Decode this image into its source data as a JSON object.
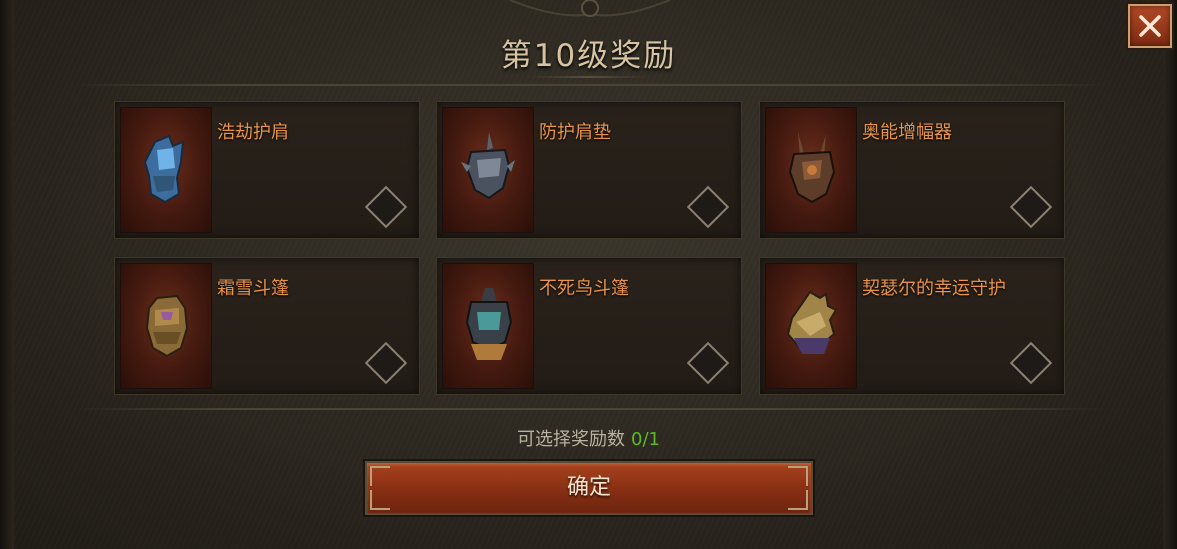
{
  "dialog": {
    "title": "第10级奖励",
    "close_icon": "close-icon"
  },
  "rewards": [
    {
      "name": "浩劫护肩",
      "icon": "shoulder-armor-blue-icon",
      "color": "#4f8fc7"
    },
    {
      "name": "防护肩垫",
      "icon": "shoulder-armor-spiked-icon",
      "color": "#6b7685"
    },
    {
      "name": "奥能增幅器",
      "icon": "shoulder-armor-horned-icon",
      "color": "#8a5a3a"
    },
    {
      "name": "霜雪斗篷",
      "icon": "shoulder-armor-gold-icon",
      "color": "#b08a4a"
    },
    {
      "name": "不死鸟斗篷",
      "icon": "shoulder-armor-teal-icon",
      "color": "#4a9a9a"
    },
    {
      "name": "契瑟尔的幸运守护",
      "icon": "shoulder-armor-dragon-icon",
      "color": "#b89a5a"
    }
  ],
  "selection": {
    "label": "可选择奖励数",
    "value": "0/1"
  },
  "confirm": {
    "label": "确定"
  },
  "colors": {
    "item_name": "#e8934a",
    "count_value": "#5cb82c",
    "button": "#8a3014"
  }
}
